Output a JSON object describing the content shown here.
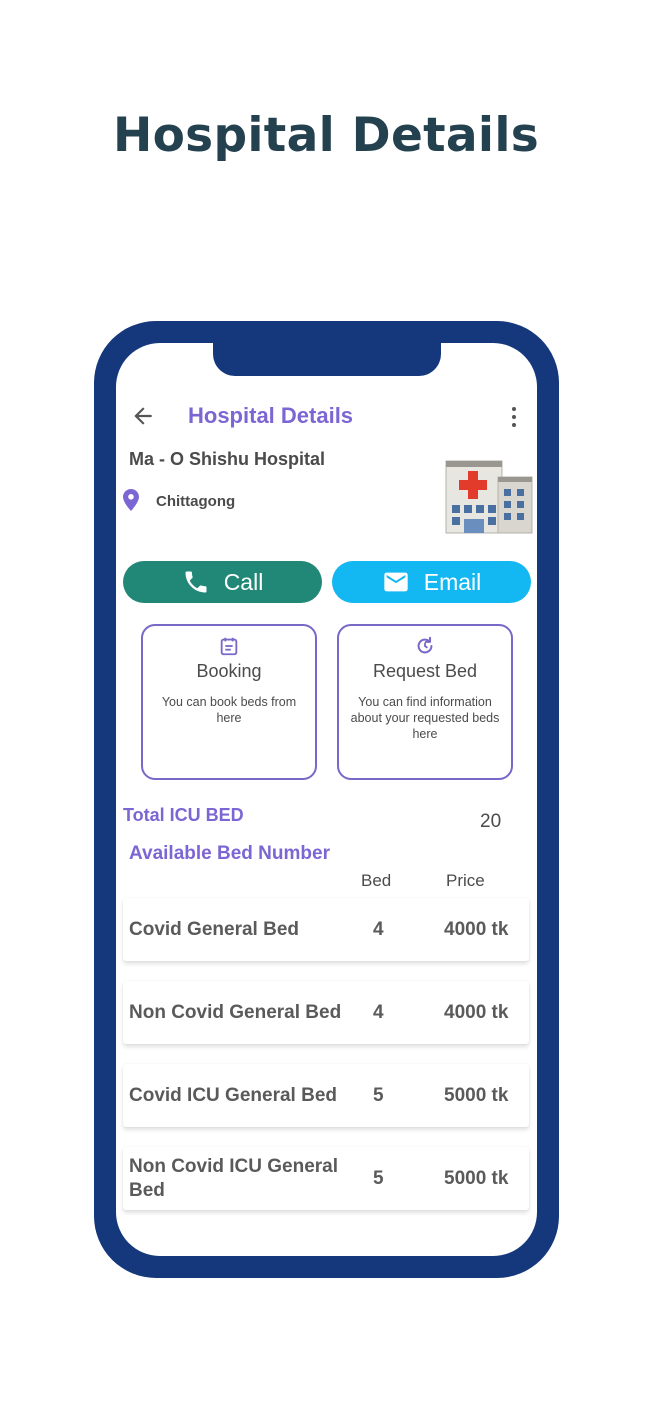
{
  "hero": {
    "title": "Hospital Details"
  },
  "appbar": {
    "title": "Hospital Details"
  },
  "hospital": {
    "name": "Ma - O Shishu Hospital",
    "location": "Chittagong"
  },
  "actions": {
    "call_label": "Call",
    "email_label": "Email"
  },
  "cards": {
    "booking": {
      "title": "Booking",
      "description": "You can book beds from here"
    },
    "request": {
      "title": "Request Bed",
      "description": "You can find information about your requested beds here"
    }
  },
  "icu": {
    "label": "Total ICU BED",
    "value": "20"
  },
  "beds": {
    "section_label": "Available Bed Number",
    "col_bed": "Bed",
    "col_price": "Price",
    "rows": [
      {
        "name": "Covid General Bed",
        "count": "4",
        "price": "4000 tk"
      },
      {
        "name": "Non Covid General Bed",
        "count": "4",
        "price": "4000 tk"
      },
      {
        "name": "Covid ICU General Bed",
        "count": "5",
        "price": "5000 tk"
      },
      {
        "name": "Non Covid ICU General Bed",
        "count": "5",
        "price": "5000 tk"
      }
    ]
  },
  "colors": {
    "frame": "#14387b",
    "accent": "#7c66d3",
    "call": "#218878",
    "email": "#13b7f2",
    "hero_text": "#24414f"
  },
  "icons": {
    "back": "arrow-left-icon",
    "menu": "more-vert-icon",
    "location": "location-pin-icon",
    "hospital": "hospital-building-icon",
    "call": "phone-icon",
    "email": "mail-icon",
    "booking": "calendar-icon",
    "request": "refresh-icon"
  }
}
